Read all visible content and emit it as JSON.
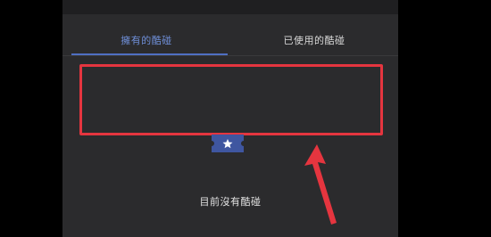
{
  "tabs": [
    {
      "label": "擁有的酷碰",
      "active": true
    },
    {
      "label": "已使用的酷碰",
      "active": false
    }
  ],
  "empty_state": {
    "icon": "coupon-ticket-star-icon",
    "message": "目前沒有酷碰"
  },
  "colors": {
    "panel_bg": "#2b2b2d",
    "accent": "#4f6fc2",
    "highlight_red": "#e5353f",
    "ticket": "#3f56a0"
  }
}
